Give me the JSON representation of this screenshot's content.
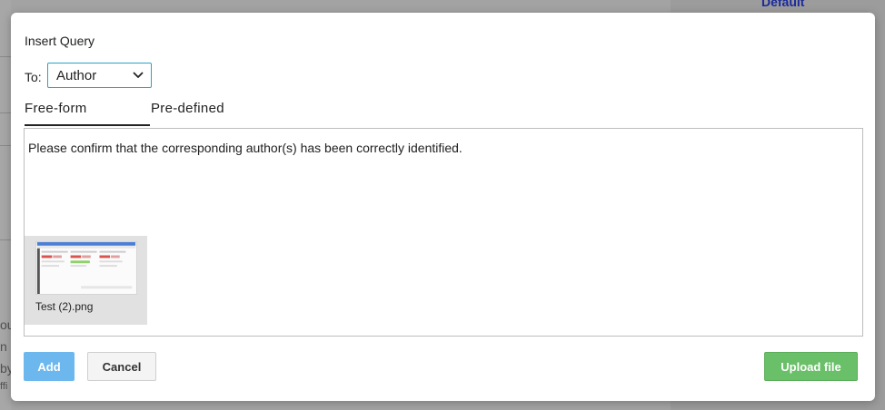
{
  "background": {
    "default_link": "Default",
    "fragments": [
      "ou",
      "n",
      "by",
      "ffi"
    ]
  },
  "dialog": {
    "title": "Insert Query",
    "to_label": "To:",
    "to_select": {
      "value": "Author"
    },
    "tabs": [
      {
        "label": "Free-form",
        "active": true
      },
      {
        "label": "Pre-defined",
        "active": false
      }
    ],
    "editor": {
      "text": "Please confirm that the corresponding author(s) has been correctly identified."
    },
    "attachment": {
      "filename": "Test (2).png"
    },
    "buttons": {
      "add": "Add",
      "cancel": "Cancel",
      "upload": "Upload file"
    }
  },
  "colors": {
    "accent": "#27a3c9",
    "add_button": "#6cb8ee",
    "upload_button": "#6abf69"
  },
  "icons": {
    "select_chevron": "chevron-down-icon"
  }
}
